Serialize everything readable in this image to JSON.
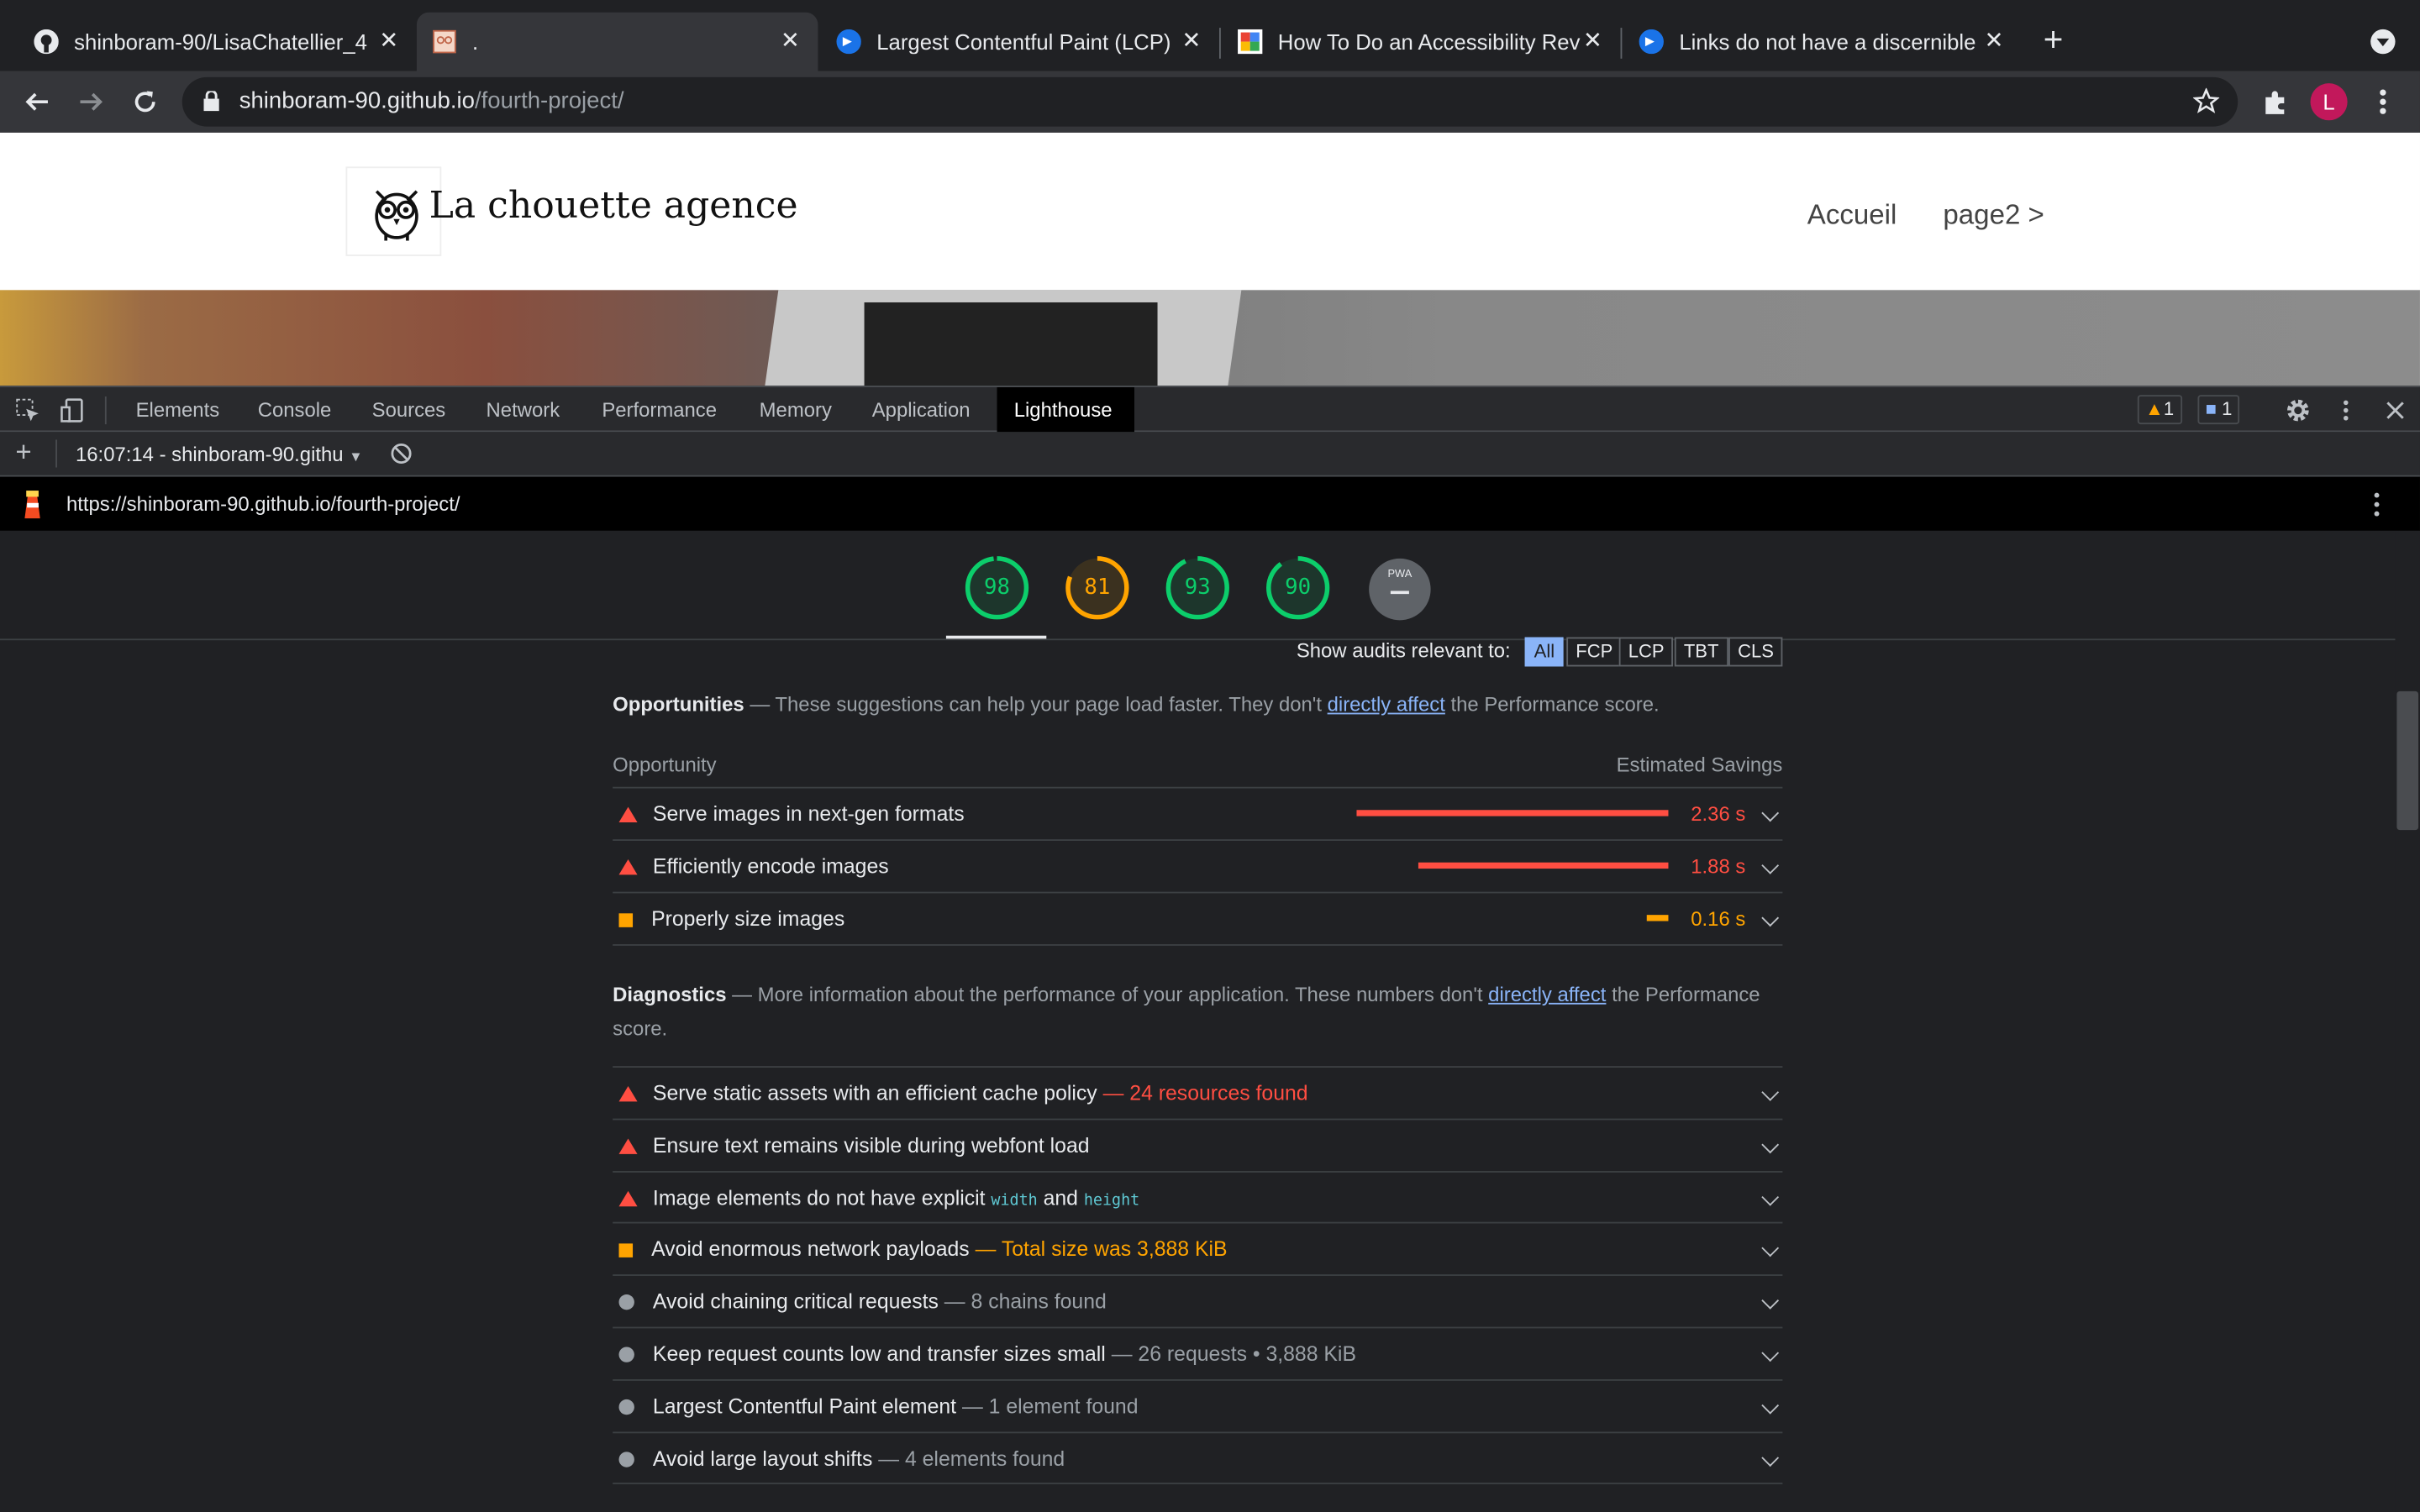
{
  "browser": {
    "tabs": [
      {
        "title": "shinboram-90/LisaChatellier_4",
        "icon": "github-icon"
      },
      {
        "title": ".",
        "icon": "owl-favicon-icon"
      },
      {
        "title": "Largest Contentful Paint (LCP)",
        "icon": "web-dev-icon"
      },
      {
        "title": "How To Do an Accessibility Rev",
        "icon": "accessibility-icon"
      },
      {
        "title": "Links do not have a discernible",
        "icon": "web-dev-icon"
      }
    ],
    "url_host": "shinboram-90.github.io",
    "url_path": "/fourth-project/",
    "profile_initial": "L"
  },
  "site": {
    "logo_text": "La chouette agence",
    "nav": [
      "Accueil",
      "page2 >"
    ]
  },
  "devtools": {
    "tabs": [
      "Elements",
      "Console",
      "Sources",
      "Network",
      "Performance",
      "Memory",
      "Application",
      "Lighthouse"
    ],
    "active_tab": "Lighthouse",
    "warnings": "1",
    "messages": "1",
    "report_selector": "16:07:14 - shinboram-90.githu",
    "report_url": "https://shinboram-90.github.io/fourth-project/"
  },
  "lighthouse": {
    "scores": [
      {
        "value": "98",
        "color": "#0cce6b"
      },
      {
        "value": "81",
        "color": "#ffa400"
      },
      {
        "value": "93",
        "color": "#0cce6b"
      },
      {
        "value": "90",
        "color": "#0cce6b"
      }
    ],
    "pwa_label": "PWA",
    "filter_label": "Show audits relevant to:",
    "filters": [
      "All",
      "FCP",
      "LCP",
      "TBT",
      "CLS"
    ],
    "opportunities": {
      "title": "Opportunities",
      "desc_pre": "These suggestions can help your page load faster. They don't ",
      "link": "directly affect",
      "desc_post": " the Performance score.",
      "col_left": "Opportunity",
      "col_right": "Estimated Savings",
      "items": [
        {
          "label": "Serve images in next-gen formats",
          "savings": "2.36 s",
          "level": "fail",
          "fraction": 1.0
        },
        {
          "label": "Efficiently encode images",
          "savings": "1.88 s",
          "level": "fail",
          "fraction": 0.8
        },
        {
          "label": "Properly size images",
          "savings": "0.16 s",
          "level": "average",
          "fraction": 0.07
        }
      ]
    },
    "diagnostics": {
      "title": "Diagnostics",
      "desc_pre": "More information about the performance of your application. These numbers don't ",
      "link": "directly affect",
      "desc_post": " the Performance score.",
      "items": [
        {
          "label": "Serve static assets with an efficient cache policy",
          "detail": "24 resources found",
          "level": "fail"
        },
        {
          "label": "Ensure text remains visible during webfont load",
          "detail": "",
          "level": "fail"
        },
        {
          "label_pre": "Image elements do not have explicit ",
          "code1": "width",
          "label_mid": " and ",
          "code2": "height",
          "level": "fail"
        },
        {
          "label": "Avoid enormous network payloads",
          "detail": "Total size was 3,888 KiB",
          "level": "average"
        },
        {
          "label": "Avoid chaining critical requests",
          "detail": "8 chains found",
          "level": "info"
        },
        {
          "label": "Keep request counts low and transfer sizes small",
          "detail": "26 requests • 3,888 KiB",
          "level": "info"
        },
        {
          "label": "Largest Contentful Paint element",
          "detail": "1 element found",
          "level": "info"
        },
        {
          "label": "Avoid large layout shifts",
          "detail": "4 elements found",
          "level": "info"
        }
      ]
    }
  }
}
